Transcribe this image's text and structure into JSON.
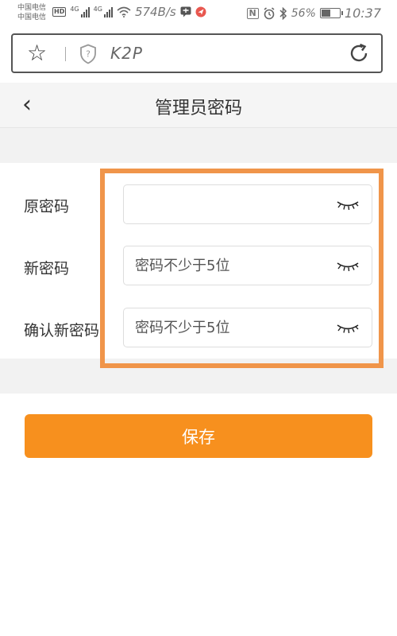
{
  "status_bar": {
    "carrier_line1": "中国电信",
    "carrier_line2": "中国电信",
    "hd": "HD",
    "net1": "4G",
    "net2": "4G",
    "speed": "574B/s",
    "nfc": "N",
    "battery_percent": "56%",
    "battery_level": 0.56,
    "time": "10:37"
  },
  "browser": {
    "url": "K2P"
  },
  "header": {
    "back_symbol": "‹",
    "title": "管理员密码"
  },
  "form": {
    "fields": [
      {
        "label": "原密码",
        "value": "",
        "placeholder": ""
      },
      {
        "label": "新密码",
        "value": "",
        "placeholder": "密码不少于5位"
      },
      {
        "label": "确认新密码",
        "value": "",
        "placeholder": "密码不少于5位"
      }
    ]
  },
  "save_label": "保存",
  "colors": {
    "accent": "#f7901e",
    "highlight": "#f0954a",
    "section_bg": "#f2f2f2"
  },
  "icons": {
    "favorite": "star-icon",
    "security": "shield-icon",
    "refresh": "reload-icon",
    "password_toggle": "eye-closed-icon"
  }
}
